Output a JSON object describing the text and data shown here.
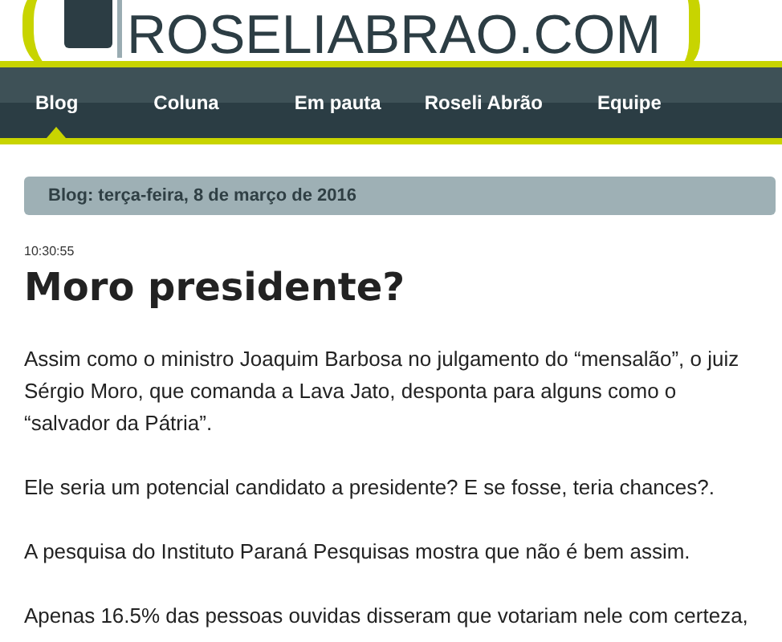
{
  "logo": {
    "text": "ROSELIABRAO.COM"
  },
  "nav": [
    {
      "label": "Blog",
      "selected": true
    },
    {
      "label": "Coluna",
      "selected": false
    },
    {
      "label": "Em pauta",
      "selected": false
    },
    {
      "label": "Roseli Abrão",
      "selected": false
    },
    {
      "label": "Equipe",
      "selected": false
    }
  ],
  "date_bar": "Blog: terça-feira, 8 de março de 2016",
  "post": {
    "time": "10:30:55",
    "title": "Moro presidente?",
    "paragraphs": [
      [
        "Assim como o ministro Joaquim Barbosa no julgamento do “mensalão”, o juiz",
        "Sérgio Moro, que comanda a Lava Jato, desponta para alguns como o",
        "“salvador da Pátria”."
      ],
      [
        "Ele seria um potencial candidato a presidente? E se fosse, teria chances?."
      ],
      [
        "A pesquisa do Instituto Paraná Pesquisas mostra que não é bem assim."
      ],
      [
        "Apenas 16.5% das pessoas ouvidas disseram que votariam nele com certeza,"
      ]
    ]
  }
}
